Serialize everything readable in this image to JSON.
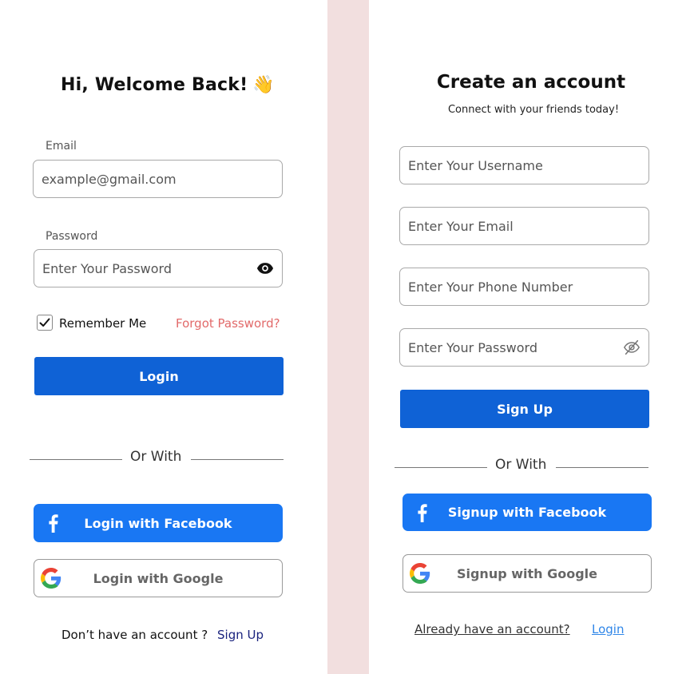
{
  "login": {
    "title": "Hi, Welcome Back!",
    "wave_emoji": "👋",
    "email_label": "Email",
    "email_placeholder": "example@gmail.com",
    "password_label": "Password",
    "password_placeholder": "Enter Your Password",
    "remember_label": "Remember Me",
    "remember_checked": true,
    "forgot_label": "Forgot Password?",
    "login_button": "Login",
    "or_with": "Or With",
    "facebook_button": "Login with Facebook",
    "google_button": "Login with Google",
    "no_account_text": "Don’t have an account ?",
    "signup_link": "Sign Up"
  },
  "signup": {
    "title": "Create an account",
    "subtitle": "Connect with your friends today!",
    "username_placeholder": "Enter Your Username",
    "email_placeholder": "Enter Your Email",
    "phone_placeholder": "Enter Your Phone Number",
    "password_placeholder": "Enter Your Password",
    "signup_button": "Sign Up",
    "or_with": "Or With",
    "facebook_button": "Signup with Facebook",
    "google_button": "Signup with Google",
    "already_text": "Already have an account?",
    "login_link": "Login"
  },
  "colors": {
    "primary": "#0f62d6",
    "facebook": "#1977f3",
    "forgot": "#e26a6a",
    "strip": "#f2dfdf",
    "link": "#2f86e8"
  },
  "icons": {
    "eye": "eye-icon",
    "eye_slash": "eye-slash-icon",
    "facebook": "facebook-icon",
    "google": "google-icon",
    "check": "checkmark-icon"
  }
}
